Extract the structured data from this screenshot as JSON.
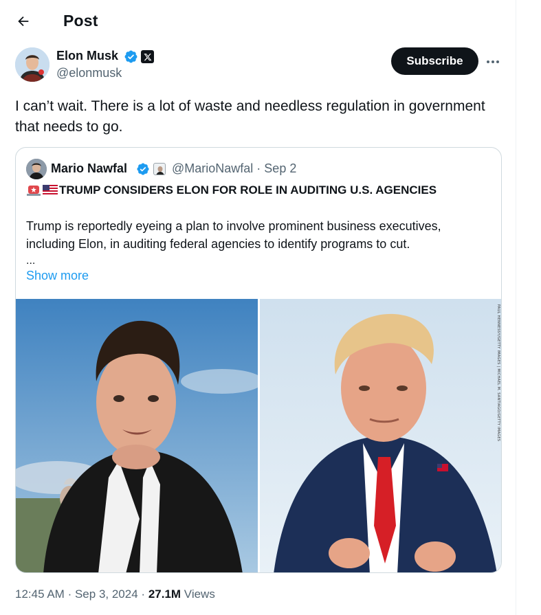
{
  "header": {
    "title": "Post"
  },
  "author": {
    "name": "Elon Musk",
    "handle": "@elonmusk",
    "verified_color": "#1d9bf0",
    "affiliation_icon": "x-logo-icon"
  },
  "actions": {
    "subscribe_label": "Subscribe",
    "more_label": "•••"
  },
  "post": {
    "text": "I can’t wait. There is a lot of waste and needless regulation in government that needs to go."
  },
  "quote": {
    "name": "Mario Nawfal",
    "handle_and_date": "@MarioNawfal · Sep 2",
    "headline": "TRUMP CONSIDERS ELON FOR ROLE IN AUDITING U.S. AGENCIES",
    "body": "Trump is reportedly eyeing a plan to involve prominent business executives, including Elon, in auditing federal agencies to identify programs to cut.",
    "ellipsis": "...",
    "show_more": "Show more",
    "photo_credit": "PAUL HENNESSY/GETTY IMAGES | MICHAEL M. SANTIAGO/GETTY IMAGES",
    "media": [
      {
        "alt_icon": "photo-left"
      },
      {
        "alt_icon": "photo-right"
      }
    ]
  },
  "meta": {
    "time": "12:45 AM",
    "date": "Sep 3, 2024",
    "views_count": "27.1M",
    "views_label": "Views",
    "separator": "·"
  },
  "colors": {
    "accent": "#1d9bf0",
    "text": "#0f1419",
    "muted": "#536471",
    "border": "#cfd9de"
  }
}
